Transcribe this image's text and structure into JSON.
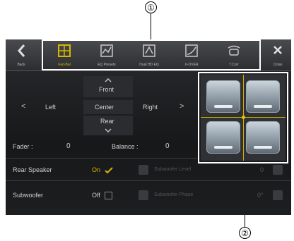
{
  "callouts": {
    "one": "①",
    "two": "②"
  },
  "topbar": {
    "back_label": "Back",
    "tabs": [
      {
        "label": "Fad-Bal",
        "icon": "fader-balance-icon"
      },
      {
        "label": "EQ Presets",
        "icon": "eq-presets-icon"
      },
      {
        "label": "Dual HD EQ",
        "icon": "dual-hd-eq-icon"
      },
      {
        "label": "X-OVER",
        "icon": "crossover-icon"
      },
      {
        "label": "T.Corr",
        "icon": "time-correction-icon"
      }
    ],
    "close_label": "Close"
  },
  "fader_balance": {
    "front": "Front",
    "left": "Left",
    "center": "Center",
    "right": "Right",
    "rear": "Rear",
    "fader_label": "Fader :",
    "fader_value": "0",
    "balance_label": "Balance :",
    "balance_value": "0"
  },
  "rear_speaker": {
    "label": "Rear Speaker",
    "value": "On"
  },
  "subwoofer": {
    "label": "Subwoofer",
    "value": "Off",
    "level_label": "Subwoofer Level",
    "level_value": "0",
    "phase_label": "Subwoofer Phase",
    "phase_value": "0°"
  },
  "colors": {
    "accent": "#d7b600",
    "background": "#1c1d1f"
  }
}
